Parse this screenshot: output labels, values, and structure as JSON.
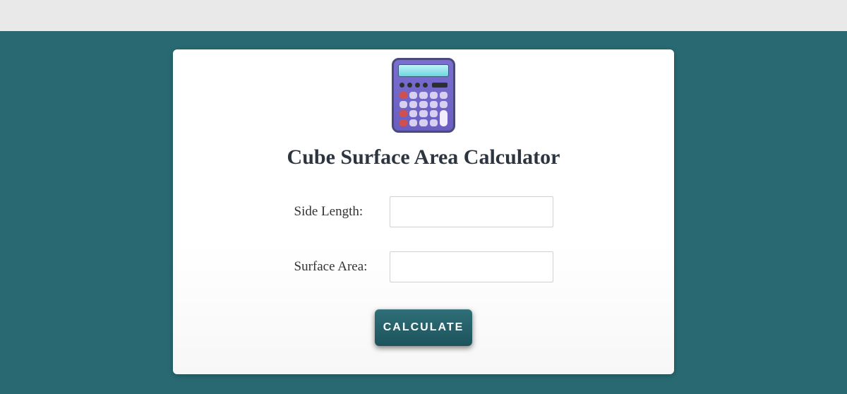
{
  "header": {
    "title": "Cube Surface Area Calculator",
    "icon": "calculator-icon"
  },
  "form": {
    "side_label": "Side Length:",
    "side_value": "",
    "surface_label": "Surface Area:",
    "surface_value": "",
    "button_label": "CALCULATE"
  }
}
